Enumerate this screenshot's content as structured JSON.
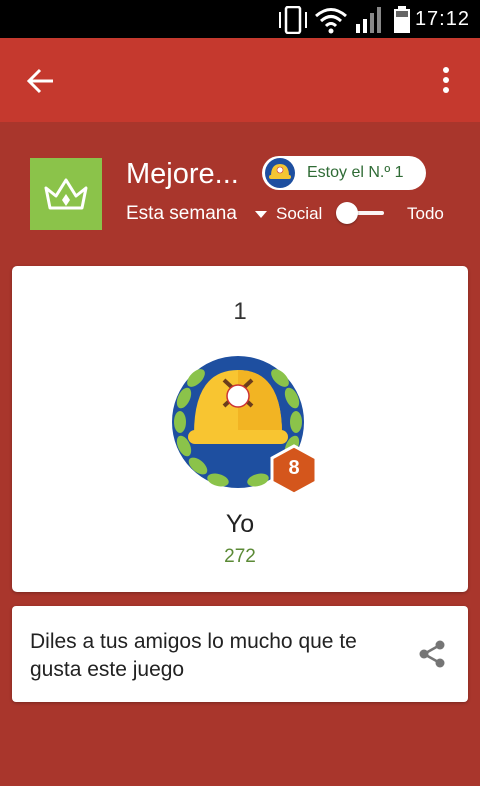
{
  "status_bar": {
    "time": "17:12",
    "icons": [
      "vibrate-icon",
      "wifi-icon",
      "signal-icon",
      "battery-icon"
    ]
  },
  "toolbar": {
    "back_icon": "arrow-left-icon",
    "menu_icon": "more-vertical-icon"
  },
  "header": {
    "icon": "crown-icon",
    "title": "Mejore...",
    "player_chip": {
      "label": "Estoy el N.º 1",
      "icon": "player-avatar-icon"
    },
    "period": "Esta semana",
    "toggle": {
      "left_label": "Social",
      "right_label": "Todo"
    }
  },
  "rank_card": {
    "rank": "1",
    "player_name": "Yo",
    "score": "272",
    "level": "8"
  },
  "share_card": {
    "text": "Diles a tus amigos lo mucho que te gusta este juego",
    "icon": "share-icon"
  },
  "colors": {
    "toolbar": "#c5392e",
    "background": "#a9362c",
    "crown_tile": "#8bc34a",
    "score_green": "#5b8a36",
    "level_badge": "#d4561c"
  }
}
